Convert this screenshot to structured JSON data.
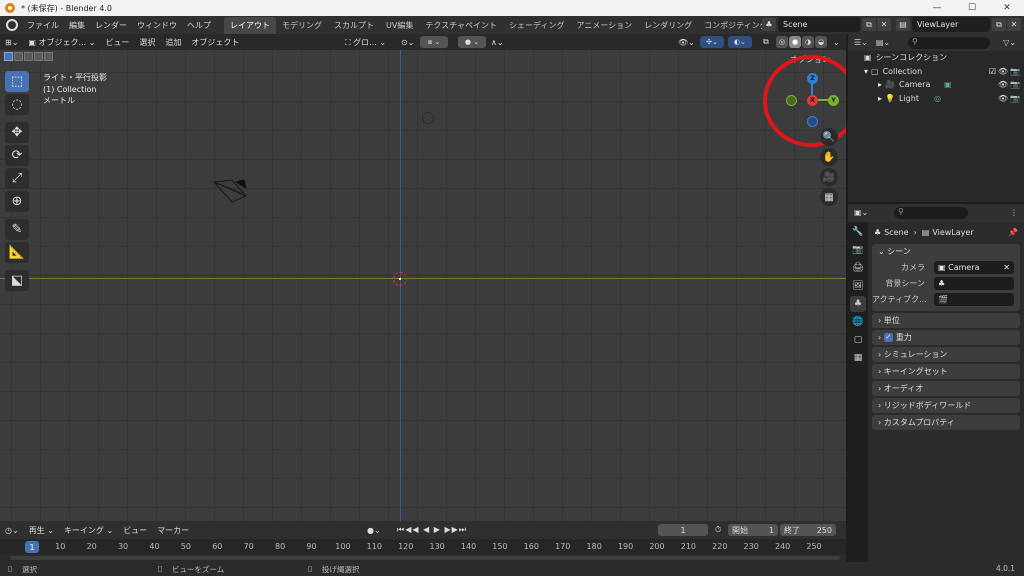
{
  "window": {
    "title": "* (未保存) - Blender 4.0",
    "min": "—",
    "max": "☐",
    "close": "✕"
  },
  "menu": [
    "ファイル",
    "編集",
    "レンダー",
    "ウィンドウ",
    "ヘルプ"
  ],
  "workspaces": [
    "レイアウト",
    "モデリング",
    "スカルプト",
    "UV編集",
    "テクスチャペイント",
    "シェーディング",
    "アニメーション",
    "レンダリング",
    "コンポジティング"
  ],
  "scene_field": "Scene",
  "viewlayer_field": "ViewLayer",
  "viewport": {
    "mode": "オブジェク...",
    "menus": [
      "ビュー",
      "選択",
      "追加",
      "オブジェクト"
    ],
    "transform_orientation": "グロ...",
    "info": [
      "ライト・平行投影",
      "(1) Collection",
      "メートル"
    ],
    "gizmo_label": "オプション",
    "gizmo_axes": {
      "z": "Z",
      "x": "X",
      "y": "Y"
    },
    "colors": {
      "x": "#e4353b",
      "y": "#7ab22a",
      "z": "#2f80d8",
      "highlight": "#e0151b"
    }
  },
  "timeline": {
    "menus": [
      "再生 ⌄",
      "キーイング ⌄",
      "ビュー",
      "マーカー"
    ],
    "current_frame": "1",
    "start_label": "開始",
    "start": "1",
    "end_label": "終了",
    "end": "250",
    "ticks": [
      "1",
      "10",
      "20",
      "30",
      "40",
      "50",
      "60",
      "70",
      "80",
      "90",
      "100",
      "110",
      "120",
      "130",
      "140",
      "150",
      "160",
      "170",
      "180",
      "190",
      "200",
      "210",
      "220",
      "230",
      "240",
      "250"
    ]
  },
  "statusbar": {
    "select": "選択",
    "zoom": "ビューをズーム",
    "lasso": "投げ縄選択",
    "version": "4.0.1"
  },
  "outliner": {
    "root": "シーンコレクション",
    "collection": "Collection",
    "items": [
      "Camera",
      "Light"
    ]
  },
  "properties": {
    "breadcrumb_scene": "Scene",
    "breadcrumb_layer": "ViewLayer",
    "scene_panel": "シーン",
    "camera_label": "カメラ",
    "camera_value": "Camera",
    "bg_scene_label": "背景シーン",
    "active_clip_label": "アクティブク...",
    "panels": [
      "単位",
      "重力",
      "シミュレーション",
      "キーイングセット",
      "オーディオ",
      "リジッドボディワールド",
      "カスタムプロパティ"
    ]
  }
}
